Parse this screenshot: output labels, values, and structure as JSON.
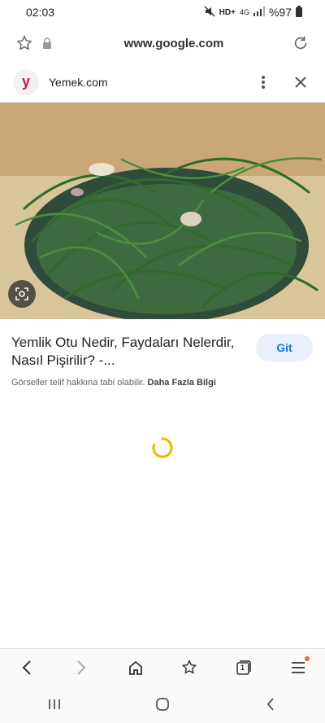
{
  "status_bar": {
    "time": "02:03",
    "network": "4G",
    "battery": "%97"
  },
  "browser": {
    "url": "www.google.com"
  },
  "site": {
    "name": "Yemek.com",
    "favicon_letter": "y"
  },
  "result": {
    "title": "Yemlik Otu Nedir, Faydaları Nelerdir, Nasıl Pişirilir? -...",
    "go_label": "Git",
    "copyright_text": "Görseller telif hakkına tabi olabilir.",
    "more_info": "Daha Fazla Bilgi"
  },
  "bottom_nav": {
    "tab_count": "1"
  },
  "colors": {
    "accent": "#1a73e8",
    "spinner": "#f4b400",
    "favicon": "#d1144f"
  }
}
